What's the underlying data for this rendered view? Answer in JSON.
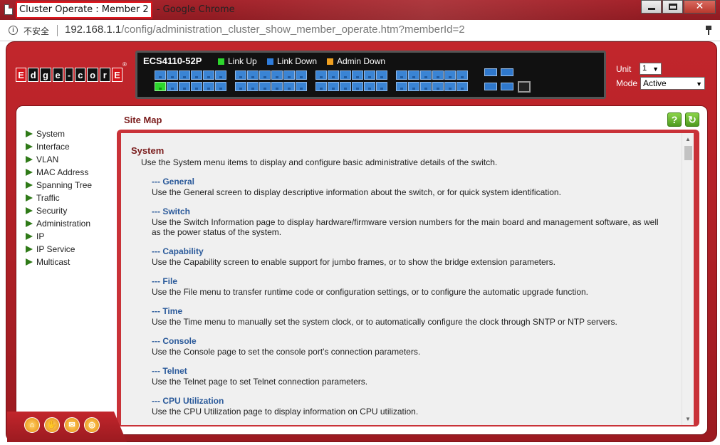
{
  "window": {
    "title": "Cluster Operate : Member 2",
    "title_suffix": " - Google Chrome",
    "minimize": "minimize",
    "maximize": "maximize",
    "close": "✕"
  },
  "address_bar": {
    "security_label": "不安全",
    "url_host": "192.168.1.1",
    "url_path": "/config/administration_cluster_show_member_operate.htm?memberId=2"
  },
  "header": {
    "logo_letters": [
      "E",
      "d",
      "g",
      "e",
      "-",
      "c",
      "o",
      "r",
      "E"
    ],
    "logo_reg": "®",
    "model": "ECS4110-52P",
    "legend": [
      {
        "label": "Link Up",
        "color": "#2dd62d"
      },
      {
        "label": "Link Down",
        "color": "#2f7ddc"
      },
      {
        "label": "Admin Down",
        "color": "#f0a020"
      }
    ],
    "unit_label": "Unit",
    "unit_value": "1",
    "mode_label": "Mode",
    "mode_value": "Active"
  },
  "sidebar": {
    "items": [
      {
        "label": "System"
      },
      {
        "label": "Interface"
      },
      {
        "label": "VLAN"
      },
      {
        "label": "MAC Address"
      },
      {
        "label": "Spanning Tree"
      },
      {
        "label": "Traffic"
      },
      {
        "label": "Security"
      },
      {
        "label": "Administration"
      },
      {
        "label": "IP"
      },
      {
        "label": "IP Service"
      },
      {
        "label": "Multicast"
      }
    ]
  },
  "main": {
    "title": "Site Map",
    "help_label": "?",
    "refresh_label": "↻",
    "section": {
      "title": "System",
      "desc": "Use the System menu items to display and configure basic administrative details of the switch."
    },
    "entries": [
      {
        "title": "--- General",
        "desc": "Use the General screen to display descriptive information about the switch, or for quick system identification."
      },
      {
        "title": "--- Switch",
        "desc": "Use the Switch Information page to display hardware/firmware version numbers for the main board and management software, as well as the power status of the system."
      },
      {
        "title": "--- Capability",
        "desc": "Use the Capability screen to enable support for jumbo frames, or to show the bridge extension parameters."
      },
      {
        "title": "--- File",
        "desc": "Use the File menu to transfer runtime code or configuration settings, or to configure the automatic upgrade function."
      },
      {
        "title": "--- Time",
        "desc": "Use the Time menu to manually set the system clock, or to automatically configure the clock through SNTP or NTP servers."
      },
      {
        "title": "--- Console",
        "desc": "Use the Console page to set the console port's connection parameters."
      },
      {
        "title": "--- Telnet",
        "desc": "Use the Telnet page to set Telnet connection parameters."
      },
      {
        "title": "--- CPU Utilization",
        "desc": "Use the CPU Utilization page to display information on CPU utilization."
      }
    ]
  },
  "footer": {
    "icons": [
      "home-icon",
      "hand-icon",
      "mail-icon",
      "globe-icon"
    ]
  }
}
